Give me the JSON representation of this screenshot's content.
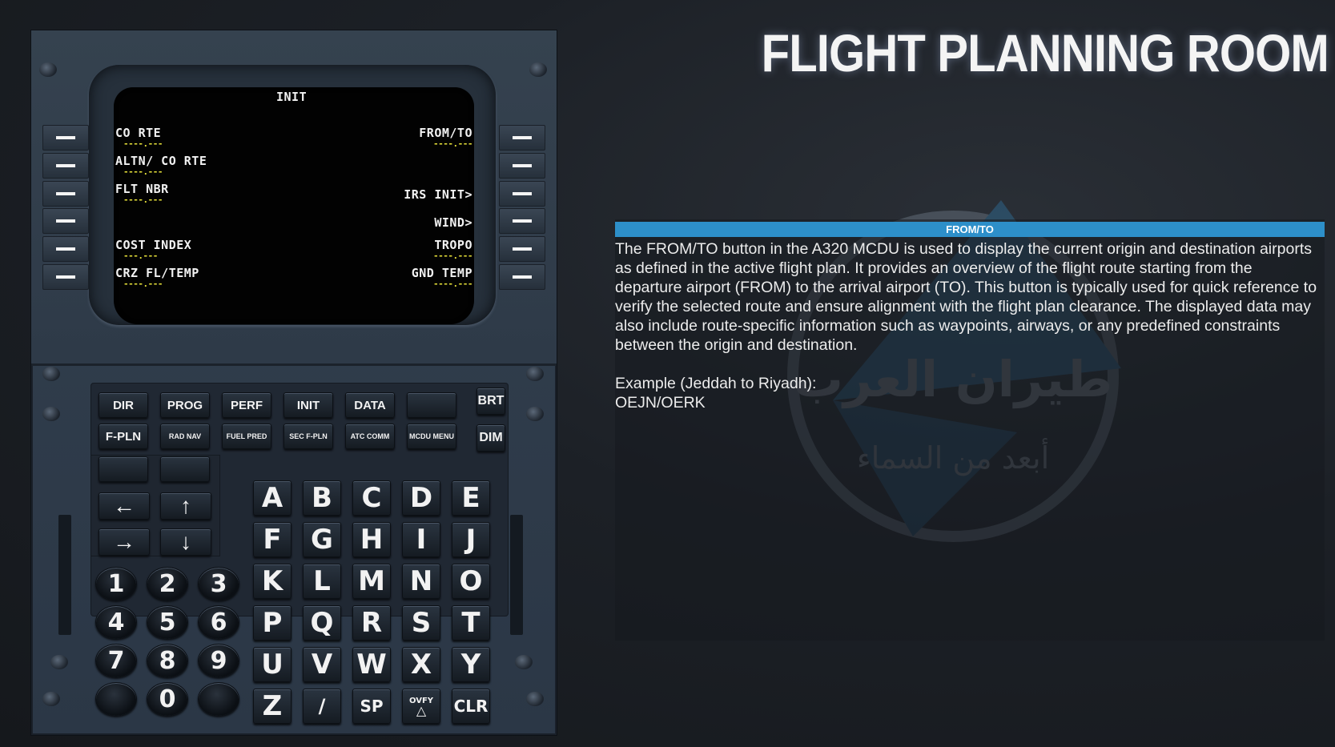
{
  "page": {
    "title": "FLIGHT PLANNING ROOM"
  },
  "mcdu": {
    "screen": {
      "header": "INIT",
      "left": [
        {
          "label": "CO RTE",
          "value": "----.---"
        },
        {
          "label": "ALTN/ CO RTE",
          "value": "----.---"
        },
        {
          "label": "FLT NBR",
          "value": "----.---"
        },
        {
          "label": "",
          "value": ""
        },
        {
          "label": "COST INDEX",
          "value": "---.---"
        },
        {
          "label": "CRZ FL/TEMP",
          "value": "----.---"
        }
      ],
      "right": [
        {
          "label": "FROM/TO",
          "value": "----.---"
        },
        {
          "label": "",
          "value": ""
        },
        {
          "label": "IRS INIT>",
          "value": ""
        },
        {
          "label": "WIND>",
          "value": ""
        },
        {
          "label": "TROPO",
          "value": "----.---"
        },
        {
          "label": "GND TEMP",
          "value": "----.---"
        }
      ]
    },
    "function_keys_row1": [
      "DIR",
      "PROG",
      "PERF",
      "INIT",
      "DATA",
      ""
    ],
    "function_keys_row2": [
      "F-PLN",
      "RAD NAV",
      "FUEL PRED",
      "SEC F-PLN",
      "ATC COMM",
      "MCDU MENU"
    ],
    "brightness": {
      "brt": "BRT",
      "dim": "DIM"
    },
    "arrows": {
      "left": "←",
      "up": "↑",
      "right": "→",
      "down": "↓"
    },
    "letters": [
      "A",
      "B",
      "C",
      "D",
      "E",
      "F",
      "G",
      "H",
      "I",
      "J",
      "K",
      "L",
      "M",
      "N",
      "O",
      "P",
      "Q",
      "R",
      "S",
      "T",
      "U",
      "V",
      "W",
      "X",
      "Y",
      "Z",
      "/",
      "SP",
      "OVFY",
      "CLR"
    ],
    "numbers": [
      "1",
      "2",
      "3",
      "4",
      "5",
      "6",
      "7",
      "8",
      "9",
      "",
      "0",
      ""
    ]
  },
  "info": {
    "header": "FROM/TO",
    "paragraph": "The FROM/TO button in the A320 MCDU is used to display the current origin and destination airports as defined in the active flight plan. It provides an overview of the flight route starting from the departure airport (FROM) to the arrival airport (TO). This button is typically used for quick reference to verify the selected route and ensure alignment with the flight plan clearance. The displayed data may also include route-specific information such as waypoints, airways, or any predefined constraints between the origin and destination.",
    "example_label": "Example (Jeddah to Riyadh):",
    "example_value": "OEJN/OERK"
  },
  "logo": {
    "text_main": "طيران العرب",
    "text_sub": "أبعد من السماء"
  }
}
